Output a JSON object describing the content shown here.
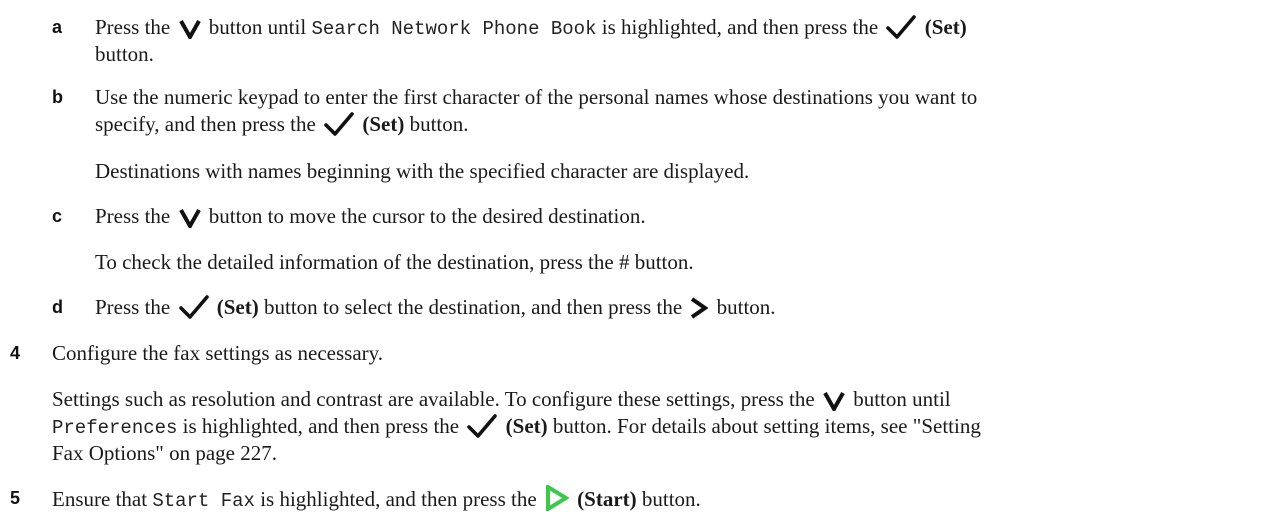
{
  "steps": {
    "a": {
      "marker": "a",
      "t1": "Press the",
      "t2": "button until",
      "code": "Search Network Phone Book",
      "t3": "is highlighted, and then press the",
      "set": "(Set)",
      "t4": "button."
    },
    "b": {
      "marker": "b",
      "line1": "Use the numeric keypad to enter the first character of the personal names whose destinations you want to",
      "line2a": "specify, and then press the",
      "set": "(Set)",
      "line2b": "button.",
      "note": "Destinations with names beginning with the specified character are displayed."
    },
    "c": {
      "marker": "c",
      "t1": "Press the",
      "t2": "button to move the cursor to the desired destination.",
      "note": "To check the detailed information of the destination, press the # button."
    },
    "d": {
      "marker": "d",
      "t1": "Press the",
      "set": "(Set)",
      "t2": "button to select the destination, and then press the",
      "t3": "button."
    },
    "s4": {
      "marker": "4",
      "text": "Configure the fax settings as necessary.",
      "p1a": "Settings such as resolution and contrast are available. To configure these settings, press the",
      "p1b": "button until",
      "code": "Preferences",
      "p2a": "is highlighted, and then press the",
      "set": "(Set)",
      "p2b": "button. For details about setting items, see \"Setting",
      "p3": "Fax Options\" on page 227."
    },
    "s5": {
      "marker": "5",
      "t1": "Ensure that",
      "code": "Start Fax",
      "t2": "is highlighted, and then press the",
      "start": "(Start)",
      "t3": "button."
    }
  },
  "icons": {
    "down": "chevron-down-icon",
    "check": "checkmark-set-icon",
    "right": "chevron-right-icon",
    "start": "start-play-icon",
    "start_color": "#3cc84a"
  }
}
